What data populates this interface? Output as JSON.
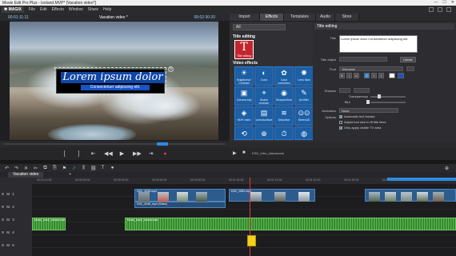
{
  "window": {
    "title": "Movie Edit Pro Plus - Iceland.MVP* [Vacation video*]"
  },
  "menubar": {
    "logo": "✱ MAGIX",
    "items": [
      "File",
      "Edit",
      "Effects",
      "Window",
      "Share",
      "Help"
    ]
  },
  "player": {
    "timecode": "00:01:11:11",
    "title": "Vacation video *",
    "timecode_end": "00:02:30:20"
  },
  "overlay": {
    "title_line": "Lorem ipsum dolor",
    "subtitle_line": "Consectetuer adipiscing elit."
  },
  "tabs": [
    {
      "label": "Import",
      "active": false
    },
    {
      "label": "Effects",
      "active": true
    },
    {
      "label": "Templates",
      "active": false
    },
    {
      "label": "Audio",
      "active": false
    },
    {
      "label": "Store",
      "active": false
    }
  ],
  "categories": {
    "selector": "All",
    "section_title": "Title editing",
    "thumb_label": "Title editing",
    "section_video": "Video effects",
    "effects": [
      "Brightness/ Contrast",
      "Color",
      "Color correction",
      "Lens flare",
      "Chroma key",
      "Shake remover",
      "Sharpen/blur",
      "Art filter",
      "HDR video",
      "Lines/surface",
      "Distortion",
      "Stereo3D"
    ]
  },
  "edit_panel": {
    "header": "Title editing",
    "title_label": "Title",
    "title_text": "Lorem ipsum dolor Consectetuer adipiscing elit.",
    "title_object_label": "Title object",
    "delete_btn": "Delete",
    "font_label": "Font",
    "font_value": "Yellowtail",
    "shadow_label": "Shadow",
    "transparency_label": "Transparency",
    "blur_label": "Blur",
    "animation_label": "Animation",
    "animation_value": "None",
    "options_label": "Options",
    "opt1": "Automatic text breaks",
    "opt2": "Adjust font size to fit title lines",
    "opt3": "Only apply visible TV area"
  },
  "timeline": {
    "project_tab": "Vacation video",
    "ruler": [
      "00:00:10:00",
      "00:00:20:00",
      "00:00:30:00",
      "00:00:40:00",
      "00:00:50:00",
      "00:01:00:00",
      "00:01:10:00",
      "00:01:20:00",
      "00:01:30:00",
      "00:01:40:00",
      "00:01:50:00"
    ],
    "track_labels": [
      "S M 1",
      "S M 2",
      "S M 3",
      "S M 4",
      "S M 5"
    ],
    "clip_labels": [
      "DSC_0045.mp4",
      "DSC_0046_mp4 (Video)",
      "DSC_0052.mp4",
      "Music_track_Iceland.wav",
      "Music_track_Iceland.wav"
    ]
  },
  "footer": {
    "filename": "DSC_intro_standsome"
  },
  "colors": {
    "accent": "#2e8be0",
    "effect_tile": "#1c5fa5",
    "title_red": "#c4252d",
    "audio": "#58b548",
    "marker": "#f2d21a"
  }
}
